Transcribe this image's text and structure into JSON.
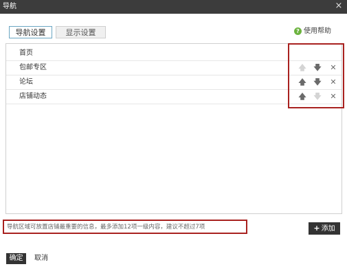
{
  "dialog": {
    "title": "导航",
    "close_icon": "×"
  },
  "tabs": [
    {
      "label": "导航设置",
      "active": true
    },
    {
      "label": "显示设置",
      "active": false
    }
  ],
  "help": {
    "icon": "?",
    "label": "使用帮助"
  },
  "nav_items": [
    {
      "label": "首页",
      "up_enabled": false,
      "down_enabled": false,
      "delete_enabled": false
    },
    {
      "label": "包邮专区",
      "up_enabled": false,
      "down_enabled": true,
      "delete_enabled": true
    },
    {
      "label": "论坛",
      "up_enabled": true,
      "down_enabled": true,
      "delete_enabled": true
    },
    {
      "label": "店铺动态",
      "up_enabled": true,
      "down_enabled": false,
      "delete_enabled": true
    }
  ],
  "row_icons": {
    "up": "🡅",
    "down": "🡇",
    "delete": "✕"
  },
  "hint": "导航区域可放置店铺最重要的信息，最多添加12项一级内容，建议不超过7项",
  "add_button": {
    "icon": "+",
    "label": "添加"
  },
  "footer": {
    "confirm_label": "确定",
    "cancel_label": "取消"
  },
  "colors": {
    "titlebar": "#3c3c3c",
    "highlight": "#a8201e",
    "help_icon": "#6cb33f"
  }
}
